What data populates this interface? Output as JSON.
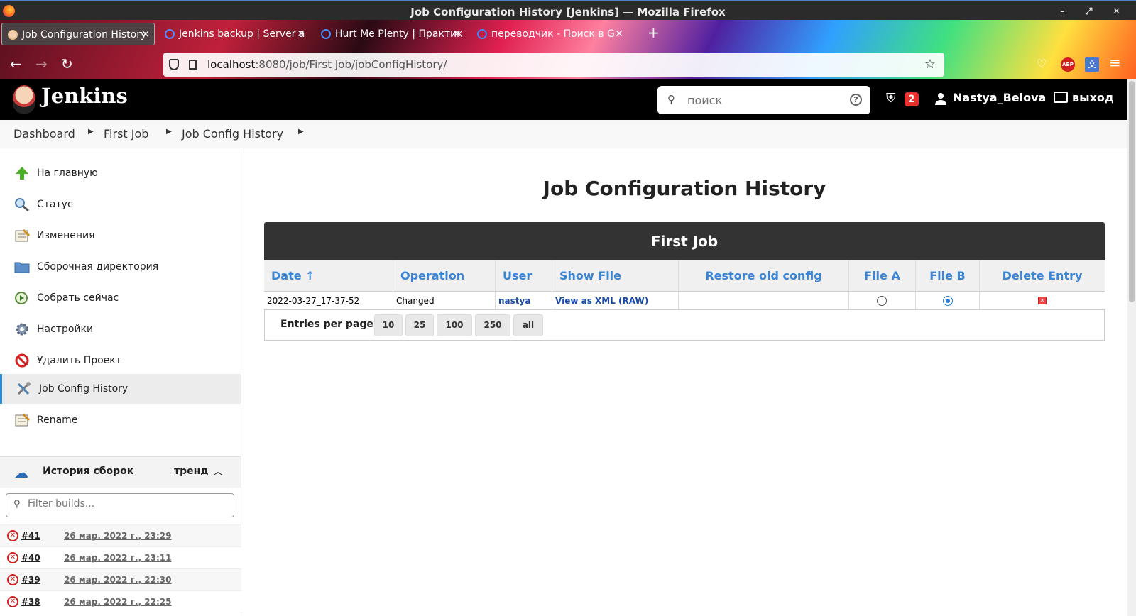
{
  "window": {
    "title": "Job Configuration History [Jenkins] — Mozilla Firefox",
    "controls": "– ⤢ ✕"
  },
  "tabs": [
    {
      "label": "Job Configuration History"
    },
    {
      "label": "Jenkins backup | Server a"
    },
    {
      "label": "Hurt Me Plenty | Практик"
    },
    {
      "label": "переводчик - Поиск в G"
    }
  ],
  "browser": {
    "url_host": "localhost",
    "url_path": ":8080/job/First Job/jobConfigHistory/",
    "new_tab": "+"
  },
  "header": {
    "brand": "Jenkins",
    "search_placeholder": "поиск",
    "alerts_count": "2",
    "username": "Nastya_Belova",
    "logout": "выход"
  },
  "breadcrumb": [
    "Dashboard",
    "First Job",
    "Job Config History"
  ],
  "sidebar": {
    "items": [
      {
        "label": "На главную",
        "icon": "up-arrow-icon"
      },
      {
        "label": "Статус",
        "icon": "magnifier-icon"
      },
      {
        "label": "Изменения",
        "icon": "notepad-icon"
      },
      {
        "label": "Сборочная директория",
        "icon": "folder-icon"
      },
      {
        "label": "Собрать сейчас",
        "icon": "clock-play-icon"
      },
      {
        "label": "Настройки",
        "icon": "gear-icon"
      },
      {
        "label": "Удалить Проект",
        "icon": "no-entry-icon"
      },
      {
        "label": "Job Config History",
        "icon": "tools-icon"
      },
      {
        "label": "Rename",
        "icon": "notepad-icon"
      }
    ],
    "history": {
      "title": "История сборок",
      "trend": "тренд",
      "filter_placeholder": "Filter builds..."
    },
    "builds": [
      {
        "num": "#41",
        "date": "26 мар. 2022 г., 23:29"
      },
      {
        "num": "#40",
        "date": "26 мар. 2022 г., 23:11"
      },
      {
        "num": "#39",
        "date": "26 мар. 2022 г., 22:30"
      },
      {
        "num": "#38",
        "date": "26 мар. 2022 г., 22:25"
      }
    ]
  },
  "main": {
    "title": "Job Configuration History",
    "job": "First Job",
    "columns": [
      "Date ↑",
      "Operation",
      "User",
      "Show File",
      "Restore old config",
      "File A",
      "File B",
      "Delete Entry"
    ],
    "rows": [
      {
        "date": "2022-03-27_17-37-52",
        "operation": "Changed",
        "user": "nastya",
        "show_file": "View as XML (RAW)",
        "file_a": false,
        "file_b": true
      }
    ],
    "entries_label": "Entries per page:",
    "page_sizes": [
      "10",
      "25",
      "100",
      "250",
      "all"
    ]
  },
  "colors": {
    "accent": "#3a85d6",
    "header_bg": "#000000",
    "danger": "#d32020"
  }
}
